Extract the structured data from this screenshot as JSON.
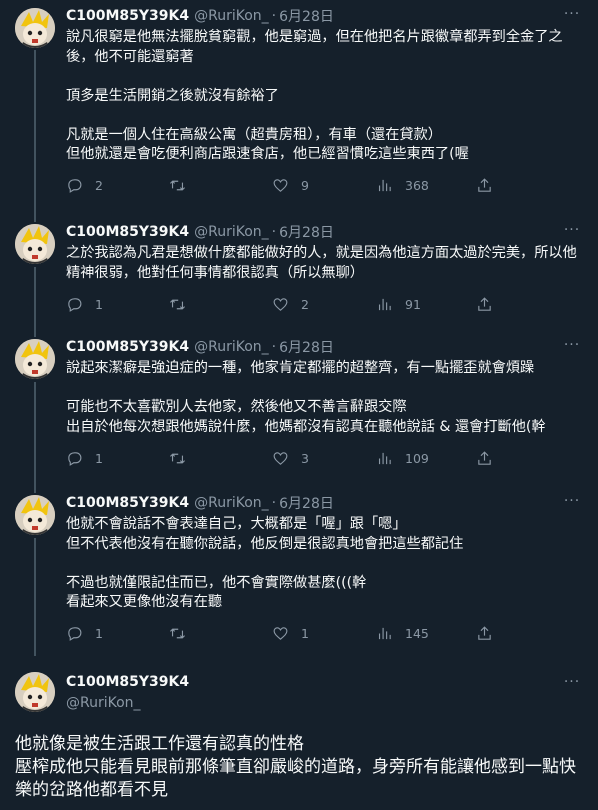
{
  "theme": {
    "background": "#15202b",
    "text": "#f7f9f9",
    "muted": "#8b98a5",
    "divider": "#38444d",
    "thread_line": "#42535f"
  },
  "tweets": [
    {
      "name": "C100M85Y39K4",
      "handle": "@RuriKon_",
      "date": "6月28日",
      "text": "說凡很窮是他無法擺脫貧窮觀，他是窮過，但在他把名片跟徽章都弄到全金了之後，他不可能還窮著\n\n頂多是生活開銷之後就沒有餘裕了\n\n凡就是一個人住在高級公寓（超貴房租），有車（還在貸款）\n但他就還是會吃便利商店跟速食店，他已經習慣吃這些東西了(喔",
      "replies": "2",
      "retweets": "",
      "likes": "9",
      "views": "368"
    },
    {
      "name": "C100M85Y39K4",
      "handle": "@RuriKon_",
      "date": "6月28日",
      "text": "之於我認為凡君是想做什麼都能做好的人，就是因為他這方面太過於完美，所以他精神很弱，他對任何事情都很認真（所以無聊）",
      "replies": "1",
      "retweets": "",
      "likes": "2",
      "views": "91"
    },
    {
      "name": "C100M85Y39K4",
      "handle": "@RuriKon_",
      "date": "6月28日",
      "text": "說起來潔癖是強迫症的一種，他家肯定都擺的超整齊，有一點擺歪就會煩躁\n\n可能也不太喜歡別人去他家，然後他又不善言辭跟交際\n出自於他每次想跟他媽說什麼，他媽都沒有認真在聽他說話 & 還會打斷他(幹",
      "replies": "1",
      "retweets": "",
      "likes": "3",
      "views": "109"
    },
    {
      "name": "C100M85Y39K4",
      "handle": "@RuriKon_",
      "date": "6月28日",
      "text": "他就不會說話不會表達自己，大概都是「喔」跟「嗯」\n但不代表他沒有在聽你說話，他反倒是很認真地會把這些都記住\n\n不過也就僅限記住而已，他不會實際做甚麼(((幹\n看起來又更像他沒有在聽",
      "replies": "1",
      "retweets": "",
      "likes": "1",
      "views": "145"
    }
  ],
  "focused": {
    "name": "C100M85Y39K4",
    "handle": "@RuriKon_",
    "text": "他就像是被生活跟工作還有認真的性格\n壓榨成他只能看見眼前那條筆直卻嚴峻的道路，身旁所有能讓他感到一點快樂的岔路他都看不見"
  },
  "icons": {
    "reply": "reply-icon",
    "retweet": "retweet-icon",
    "like": "heart-icon",
    "views": "views-icon",
    "share": "share-icon",
    "more": "more-icon"
  },
  "more_glyph": "···"
}
